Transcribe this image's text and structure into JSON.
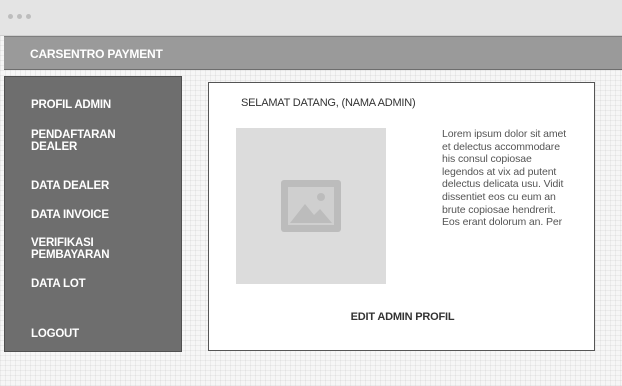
{
  "window": {
    "title": ""
  },
  "app": {
    "title": "CARSENTRO PAYMENT"
  },
  "sidebar": {
    "items": [
      {
        "label": "PROFIL ADMIN"
      },
      {
        "label": "PENDAFTARAN\nDEALER"
      },
      {
        "label": "DATA DEALER"
      },
      {
        "label": "DATA INVOICE"
      },
      {
        "label": "VERIFIKASI\nPEMBAYARAN"
      },
      {
        "label": "DATA LOT"
      },
      {
        "label": "LOGOUT"
      }
    ]
  },
  "main": {
    "welcome": "SELAMAT DATANG, (NAMA ADMIN)",
    "image_icon": "image-placeholder-icon",
    "body_text": "Lorem ipsum dolor sit amet et delectus accommodare his consul copiosae legendos at vix ad putent delectus delicata usu. Vidit dissentiet eos cu eum an brute copiosae hendrerit. Eos erant dolorum an. Per",
    "edit_label": "EDIT ADMIN PROFIL"
  },
  "colors": {
    "appbar": "#9a9a9a",
    "sidebar": "#6e6e6e",
    "placeholder": "#dcdcdc"
  }
}
